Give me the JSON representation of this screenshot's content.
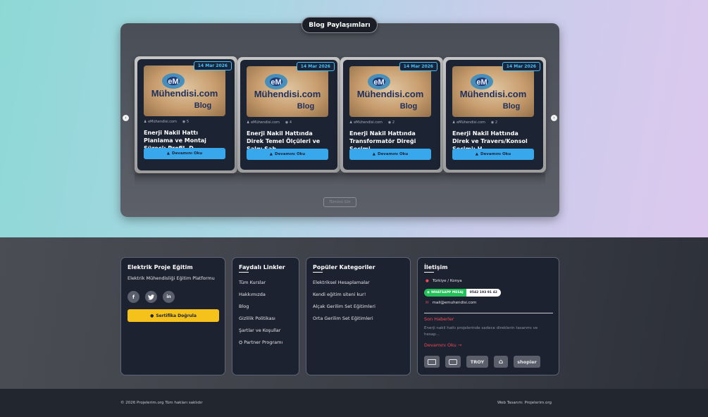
{
  "blog": {
    "title": "Blog Paylaşımları",
    "prev_icon": "‹",
    "next_icon": "›",
    "show_all_label": "Tümünü Gör",
    "posts": [
      {
        "date": "14 Mar 2026",
        "author": "eMühendisi.com",
        "views": "5",
        "title": "Enerji Nakil Hattı Planlama ve Montaj Süreci: Profil, D...",
        "button": "Devamını Oku"
      },
      {
        "date": "14 Mar 2026",
        "author": "eMühendisi.com",
        "views": "4",
        "title": "Enerji Nakil Hattında Direk Temel Ölçüleri ve Salgı Şab...",
        "button": "Devamını Oku"
      },
      {
        "date": "14 Mar 2026",
        "author": "eMühendisi.com",
        "views": "2",
        "title": "Enerji Nakil Hattında Transformatör Direği Seçimi",
        "button": "Devamını Oku"
      },
      {
        "date": "14 Mar 2026",
        "author": "eMühendisi.com",
        "views": "2",
        "title": "Enerji Nakil Hattında Direk ve Travers/Konsol Seçimi: H...",
        "button": "Devamını Oku"
      }
    ],
    "image_logo_text": "Mühendisi.com",
    "image_logo_sub": "Blog",
    "image_logo_mark": "eM"
  },
  "footer": {
    "about": {
      "title": "Elektrik Proje Eğitim",
      "subtitle": "Elektrik Mühendisliği Eğitim Platformu",
      "socials": [
        "f",
        "t",
        "in"
      ],
      "certificate_button": "Sertifika Doğrula"
    },
    "useful_links": {
      "title": "Faydalı Linkler",
      "items": [
        "Tüm Kurslar",
        "Hakkımızda",
        "Blog",
        "Gizlilik Politikası",
        "Şartlar ve Koşullar",
        "Partner Programı"
      ]
    },
    "categories": {
      "title": "Popüler Kategoriler",
      "items": [
        "Elektriksel Hesaplamalar",
        "Kendi eğitim siteni kur!",
        "Alçak Gerilim Set Eğitimleri",
        "Orta Gerilim Set Eğitimleri"
      ]
    },
    "contact": {
      "title": "İletişim",
      "location": "Türkiye / Konya",
      "whatsapp_label": "WHATSAPP MESAJ",
      "phone": "0542 193 91 42",
      "email": "mail@emuhendisi.com",
      "news_title": "Son Haberler",
      "news_text": "Enerji nakil hattı projelerinde sadece direklerin tasarımı ve hesap...",
      "news_link": "Devamını Oku",
      "payments": [
        "VISA",
        "MC",
        "TROY",
        "BANK",
        "shopier"
      ]
    }
  },
  "bottom": {
    "copyright": "© 2026 Projelerim.org Tüm hakları saklıdır",
    "designer": "Web Tasarım: Projelerim.org"
  },
  "colors": {
    "accent": "#39a7ec",
    "date_badge": "#49c0f4",
    "certificate": "#f4c21b",
    "news": "#ef4a55",
    "whatsapp": "#25c05a"
  }
}
